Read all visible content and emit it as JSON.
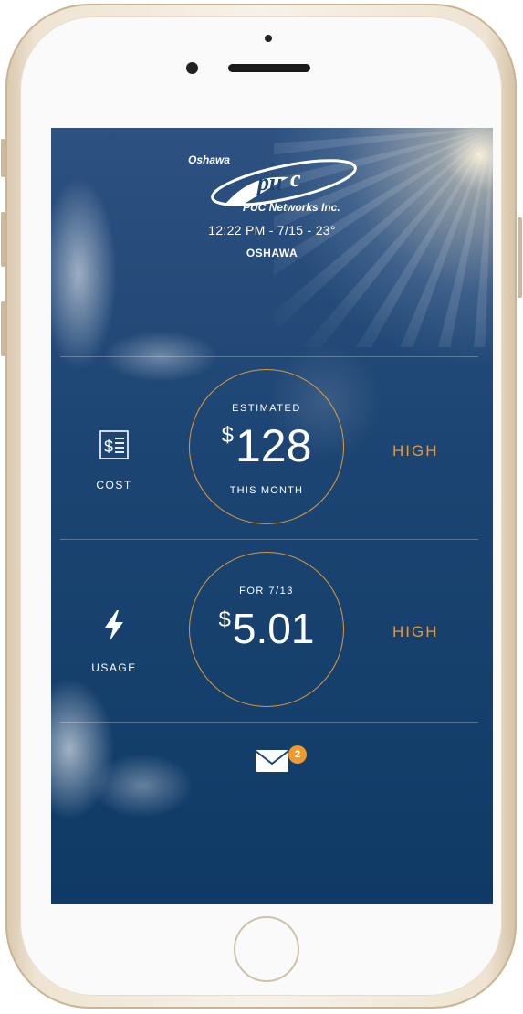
{
  "header": {
    "logo_city": "Oshawa",
    "logo_company": "PUC Networks Inc.",
    "time_date_temp": "12:22 PM - 7/15 - 23°",
    "city": "OSHAWA"
  },
  "cost_section": {
    "icon": "bill-icon",
    "label": "COST",
    "ring_top": "ESTIMATED",
    "currency": "$",
    "amount": "128",
    "ring_bottom": "THIS MONTH",
    "level": "HIGH"
  },
  "usage_section": {
    "icon": "lightning-icon",
    "label": "USAGE",
    "ring_top": "FOR 7/13",
    "currency": "$",
    "amount": "5.01",
    "level": "HIGH"
  },
  "messages": {
    "icon": "envelope-icon",
    "badge_count": "2"
  },
  "colors": {
    "accent": "#e09a3a",
    "badge": "#f1992a",
    "background": "#1d4573"
  }
}
